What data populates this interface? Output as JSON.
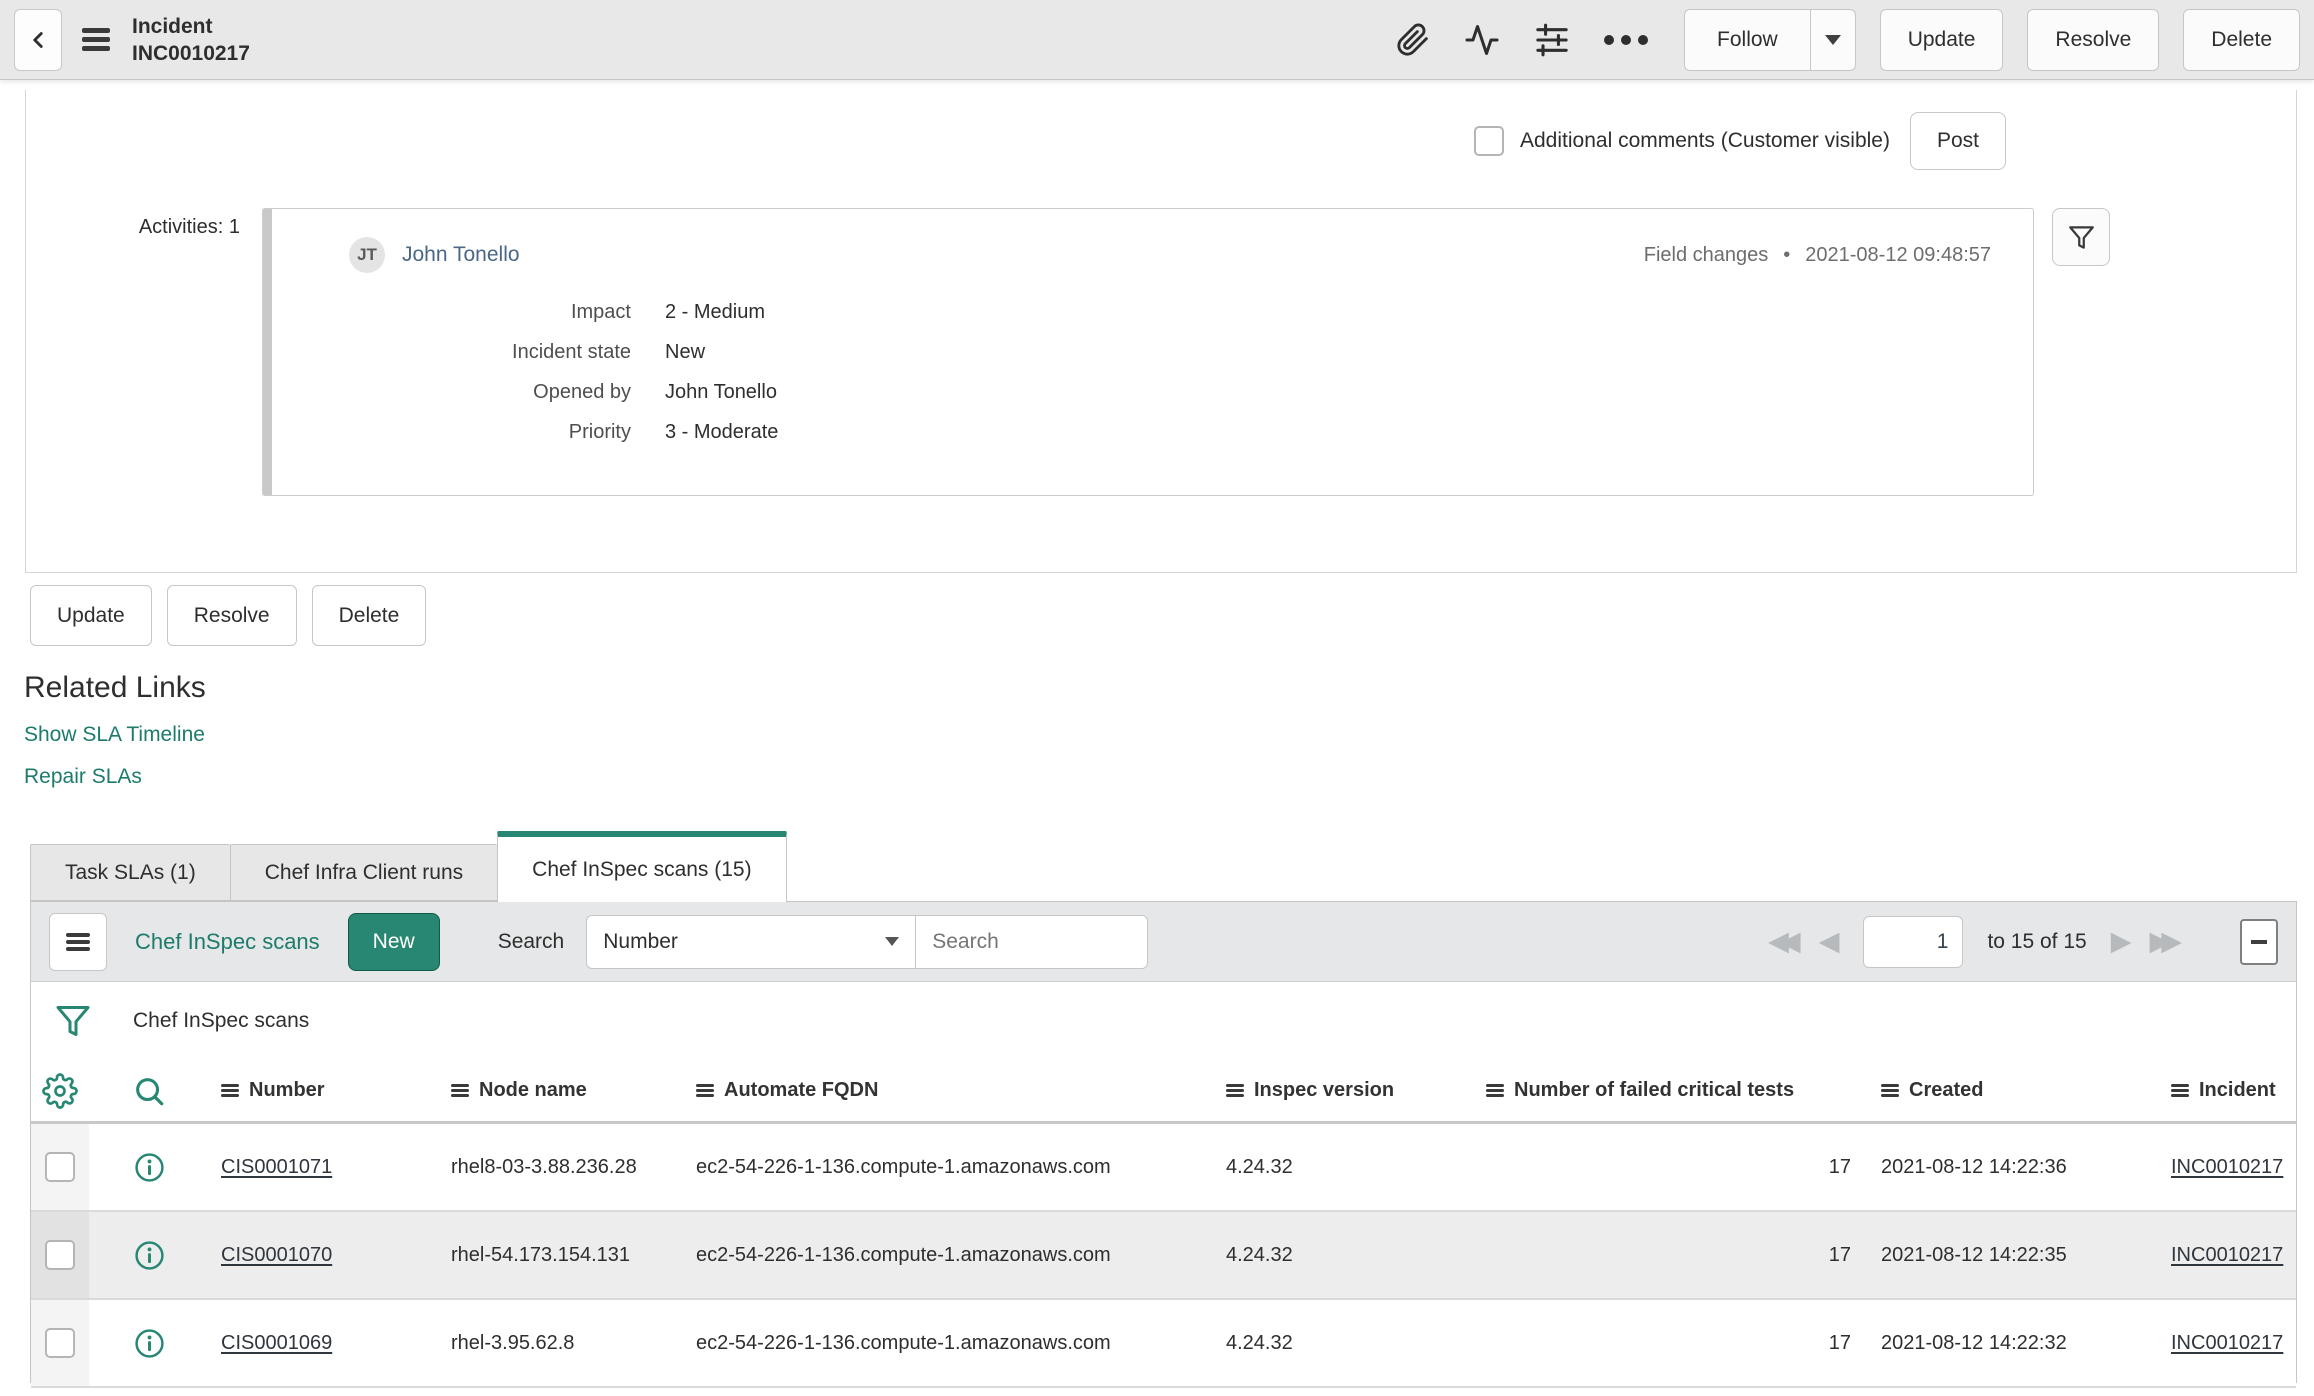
{
  "app_header": {
    "title_line1": "Incident",
    "title_line2": "INC0010217",
    "follow_label": "Follow",
    "update_label": "Update",
    "resolve_label": "Resolve",
    "delete_label": "Delete"
  },
  "comment_bar": {
    "checkbox_label": "Additional comments (Customer visible)",
    "post_label": "Post"
  },
  "activities": {
    "count_label": "Activities: 1",
    "entry": {
      "avatar_initials": "JT",
      "author": "John Tonello",
      "event_type": "Field changes",
      "separator": "•",
      "timestamp": "2021-08-12 09:48:57",
      "fields": [
        {
          "label": "Impact",
          "value": "2 - Medium"
        },
        {
          "label": "Incident state",
          "value": "New"
        },
        {
          "label": "Opened by",
          "value": "John Tonello"
        },
        {
          "label": "Priority",
          "value": "3 - Moderate"
        }
      ]
    }
  },
  "form_actions": {
    "update_label": "Update",
    "resolve_label": "Resolve",
    "delete_label": "Delete"
  },
  "related_links": {
    "title": "Related Links",
    "links": [
      {
        "label": "Show SLA Timeline"
      },
      {
        "label": "Repair SLAs"
      }
    ]
  },
  "tabs": [
    {
      "label": "Task SLAs (1)"
    },
    {
      "label": "Chef Infra Client runs"
    },
    {
      "label": "Chef InSpec scans (15)"
    }
  ],
  "list": {
    "toolbar": {
      "title": "Chef InSpec scans",
      "new_label": "New",
      "search_label": "Search",
      "search_field_value": "Number",
      "search_placeholder": "Search",
      "page_value": "1",
      "range_label": "to 15 of 15",
      "first_glyph": "◀◀",
      "prev_glyph": "◀",
      "next_glyph": "▶",
      "last_glyph": "▶▶"
    },
    "breadcrumb": "Chef InSpec scans",
    "columns": [
      "Number",
      "Node name",
      "Automate FQDN",
      "Inspec version",
      "Number of failed critical tests",
      "Created",
      "Incident"
    ],
    "rows": [
      {
        "number": "CIS0001071",
        "node_name": "rhel8-03-3.88.236.28",
        "automate_fqdn": "ec2-54-226-1-136.compute-1.amazonaws.com",
        "inspec_version": "4.24.32",
        "failed_critical_tests": "17",
        "created": "2021-08-12 14:22:36",
        "incident": "INC0010217"
      },
      {
        "number": "CIS0001070",
        "node_name": "rhel-54.173.154.131",
        "automate_fqdn": "ec2-54-226-1-136.compute-1.amazonaws.com",
        "inspec_version": "4.24.32",
        "failed_critical_tests": "17",
        "created": "2021-08-12 14:22:35",
        "incident": "INC0010217"
      },
      {
        "number": "CIS0001069",
        "node_name": "rhel-3.95.62.8",
        "automate_fqdn": "ec2-54-226-1-136.compute-1.amazonaws.com",
        "inspec_version": "4.24.32",
        "failed_critical_tests": "17",
        "created": "2021-08-12 14:22:32",
        "incident": "INC0010217"
      }
    ]
  },
  "colors": {
    "accent_teal": "#278772",
    "link_teal": "#1d7b6c",
    "header_bg": "#e8e8e8",
    "toolbar_bg": "#e5e7e8",
    "row_alt_bg": "#ededed"
  }
}
